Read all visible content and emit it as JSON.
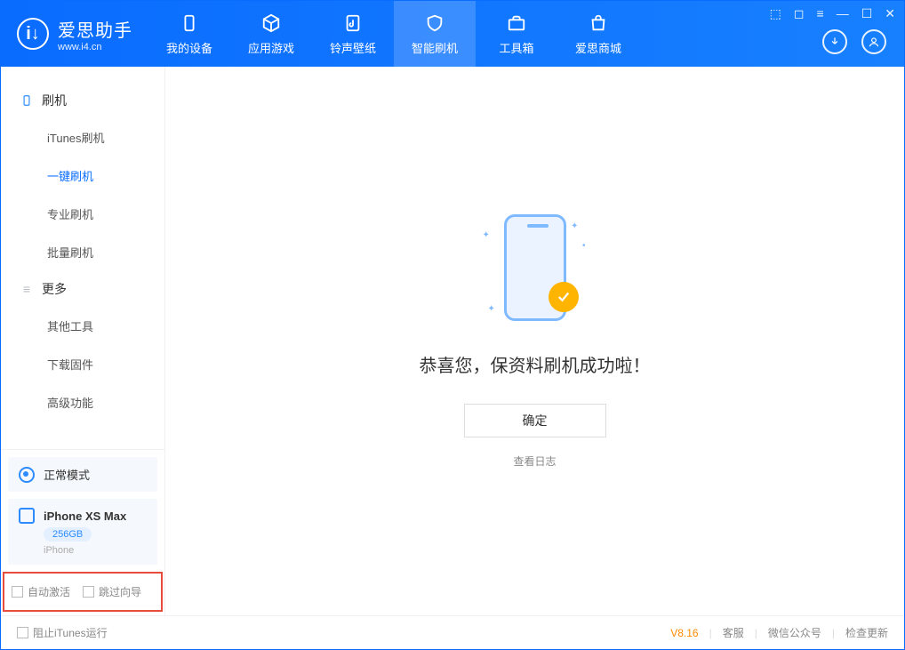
{
  "app": {
    "name_cn": "爱思助手",
    "name_en": "www.i4.cn"
  },
  "tabs": {
    "device": "我的设备",
    "apps": "应用游戏",
    "ringtones": "铃声壁纸",
    "flash": "智能刷机",
    "toolbox": "工具箱",
    "store": "爱思商城"
  },
  "sidebar": {
    "group1": {
      "title": "刷机",
      "items": [
        "iTunes刷机",
        "一键刷机",
        "专业刷机",
        "批量刷机"
      ],
      "active_index": 1
    },
    "group2": {
      "title": "更多",
      "items": [
        "其他工具",
        "下载固件",
        "高级功能"
      ]
    }
  },
  "mode": {
    "label": "正常模式"
  },
  "device": {
    "name": "iPhone XS Max",
    "capacity": "256GB",
    "type": "iPhone"
  },
  "checks": {
    "auto_activate": "自动激活",
    "skip_guide": "跳过向导"
  },
  "main": {
    "success": "恭喜您，保资料刷机成功啦！",
    "ok": "确定",
    "view_log": "查看日志"
  },
  "footer": {
    "block_itunes": "阻止iTunes运行",
    "version": "V8.16",
    "support": "客服",
    "wechat": "微信公众号",
    "check_update": "检查更新"
  }
}
